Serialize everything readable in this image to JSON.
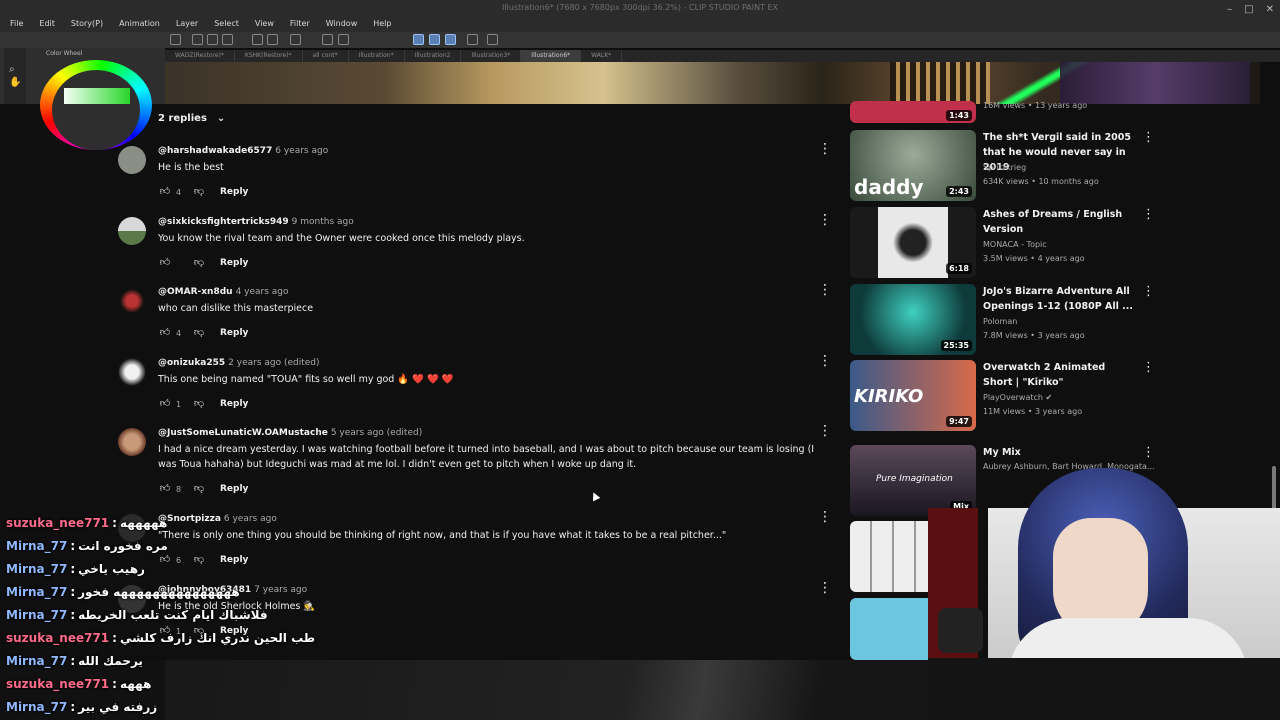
{
  "app": {
    "title": "Illustration6* (7680 x 7680px 300dpi 36.2%) - CLIP STUDIO PAINT EX",
    "menu": [
      "File",
      "Edit",
      "Story(P)",
      "Animation",
      "Layer",
      "Select",
      "View",
      "Filter",
      "Window",
      "Help"
    ],
    "panel_tab": "Color Wheel",
    "doc_tabs": [
      "WADZ(Restore)*",
      "KSHK(Restore)*",
      "all cont*",
      "Illustration*",
      "Illustration2",
      "Illustration3*",
      "Illustration6*",
      "WALK*"
    ],
    "active_tab_index": 6
  },
  "comments": {
    "replies_toggle": "2 replies",
    "items": [
      {
        "handle": "@harshadwakade6577",
        "time": "6 years ago",
        "text": "He is the best",
        "likes": "4",
        "reply": "Reply",
        "avatar_color": "#8a8f86"
      },
      {
        "handle": "@sixkicksfightertricks949",
        "time": "9 months ago",
        "text": "You know the rival team and the Owner were cooked once this melody plays.",
        "likes": "",
        "reply": "Reply",
        "avatar_color": "#5a7a4a"
      },
      {
        "handle": "@OMAR-xn8du",
        "time": "4 years ago",
        "text": "who can dislike this masterpiece",
        "likes": "4",
        "reply": "Reply",
        "avatar_color": "#7a2222"
      },
      {
        "handle": "@onizuka255",
        "time": "2 years ago (edited)",
        "text": "This one being named \"TOUA\" fits so well my god 🔥 ❤️ ❤️ ❤️",
        "likes": "1",
        "reply": "Reply",
        "avatar_color": "#d8d8d8"
      },
      {
        "handle": "@JustSomeLunaticW.OAMustache",
        "time": "5 years ago (edited)",
        "text": "I had a nice dream yesterday. I was watching football before it turned into baseball, and I was about to pitch because our team is losing (I was Toua hahaha) but Ideguchi was mad at me lol. I didn't even get to pitch when I woke up dang it.",
        "likes": "8",
        "reply": "Reply",
        "avatar_color": "#8a5a44"
      },
      {
        "handle": "@Snortpizza",
        "time": "6 years ago",
        "text": "\"There is only one thing you should be thinking of right now, and that is if you have what it takes to be a real pitcher...\"",
        "likes": "6",
        "reply": "Reply",
        "avatar_color": "#444444"
      },
      {
        "handle": "@johnnyboy63481",
        "time": "7 years ago",
        "text": "He is the old Sherlock Holmes 🕵️",
        "likes": "1",
        "reply": "Reply",
        "avatar_color": "#3a3a3a"
      }
    ]
  },
  "sidebar": {
    "videos": [
      {
        "title": "",
        "channel": "",
        "stats": "16M views • 13 years ago",
        "duration": "1:43",
        "thumb_color": "#c0304a"
      },
      {
        "title": "The sh*t Vergil said in 2005 that he would never say in 2019",
        "channel": "Spritzkrieg",
        "stats": "634K views • 10 months ago",
        "duration": "2:43",
        "thumb_color": "#5a6a5a",
        "thumb_text": "daddy"
      },
      {
        "title": "Ashes of Dreams / English Version",
        "channel": "MONACA - Topic",
        "stats": "3.5M views • 4 years ago",
        "duration": "6:18",
        "thumb_color": "#d8d8d8"
      },
      {
        "title": "JoJo's Bizarre Adventure All Openings 1-12 (1080P All ...",
        "channel": "Poloman",
        "stats": "7.8M views • 3 years ago",
        "duration": "25:35",
        "thumb_color": "#1b6a6a"
      },
      {
        "title": "Overwatch 2 Animated Short | \"Kiriko\"",
        "channel": "PlayOverwatch ✔",
        "stats": "11M views • 3 years ago",
        "duration": "9:47",
        "thumb_color": "#b34a3a",
        "thumb_text": "KIRIKO"
      },
      {
        "title": "My Mix",
        "channel": "Aubrey Ashburn, Bart Howard, Monogata...",
        "stats": "",
        "duration": "Mix",
        "thumb_color": "#3a2f3a",
        "thumb_text": "Pure Imagination"
      },
      {
        "title": "",
        "channel": "",
        "stats": "",
        "duration": "",
        "thumb_color": "#cfcfcf"
      },
      {
        "title": "",
        "channel": "",
        "stats": "",
        "duration": "",
        "thumb_color": "#6cc6e0"
      }
    ]
  },
  "chat": {
    "messages": [
      {
        "user": "suzuka_nee771",
        "color": "pink",
        "text": "هههههه"
      },
      {
        "user": "Mirna_77",
        "color": "blue",
        "text": "مره فخوره انت"
      },
      {
        "user": "Mirna_77",
        "color": "blue",
        "text": "رهيب ياخي"
      },
      {
        "user": "Mirna_77",
        "color": "blue",
        "text": "هههههههههههههههه فخور"
      },
      {
        "user": "Mirna_77",
        "color": "blue",
        "text": "فلاشباك ايام كنت تلعب الخريطه"
      },
      {
        "user": "suzuka_nee771",
        "color": "pink",
        "text": "طب الحين ندري انك زارف كلشي"
      },
      {
        "user": "Mirna_77",
        "color": "blue",
        "text": "يرحمك الله"
      },
      {
        "user": "suzuka_nee771",
        "color": "pink",
        "text": "هههه"
      },
      {
        "user": "Mirna_77",
        "color": "blue",
        "text": "زرفته في بير"
      }
    ]
  }
}
